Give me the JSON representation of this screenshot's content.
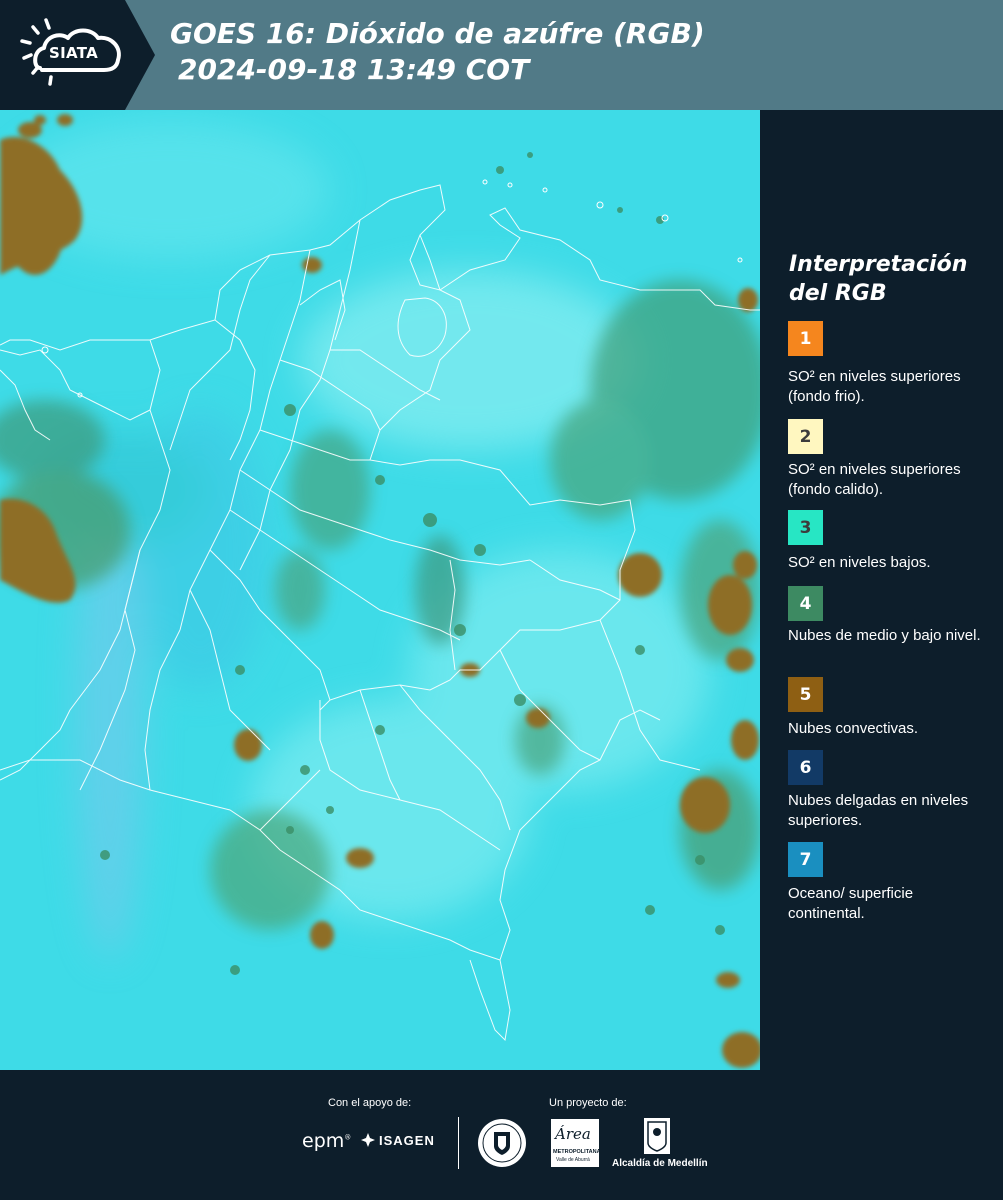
{
  "header": {
    "logo_text": "SIATA",
    "title_line1": "GOES 16: Dióxido de azúfre (RGB)",
    "title_line2": "2024-09-18 13:49 COT"
  },
  "legend": {
    "title_line1": "Interpretación",
    "title_line2": "del RGB",
    "items": [
      {
        "number": "1",
        "color": "#f5861e",
        "label": "SO² en niveles superiores (fondo frio)."
      },
      {
        "number": "2",
        "color": "#fff7c0",
        "label": "SO² en niveles superiores (fondo calido)."
      },
      {
        "number": "3",
        "color": "#27e6c4",
        "label": "SO² en niveles bajos."
      },
      {
        "number": "4",
        "color": "#3d8a62",
        "label": "Nubes de medio y bajo nivel."
      },
      {
        "number": "5",
        "color": "#8e5f13",
        "label": "Nubes convectivas."
      },
      {
        "number": "6",
        "color": "#123a66",
        "label": "Nubes delgadas en niveles superiores."
      },
      {
        "number": "7",
        "color": "#1a8fc0",
        "label": "Oceano/ superficie continental."
      }
    ]
  },
  "footer": {
    "support_label": "Con el apoyo de:",
    "project_label": "Un proyecto de:",
    "epm_logo": "epm",
    "isagen_logo": "ISAGEN",
    "metro_logo_script": "Área",
    "metro_logo_line1": "METROPOLITANA",
    "metro_logo_line2": "Valle de Aburrá",
    "medellin_logo": "Alcaldía de Medellín"
  }
}
